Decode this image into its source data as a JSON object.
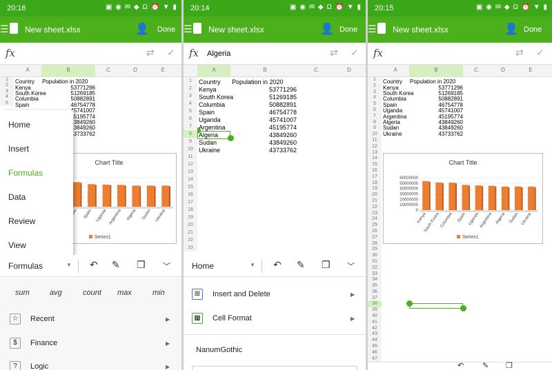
{
  "colors": {
    "accent": "#4caf1c",
    "status_bar": "#3aa818",
    "series": "#ed7d31"
  },
  "app": {
    "done": "Done"
  },
  "status": {
    "icons": "▣ ◉ ✉ ◆ Ω ⏰ ▼ ▮"
  },
  "panel1": {
    "time": "20:16",
    "title": "New sheet.xlsx",
    "fx_value": "",
    "toolbar_label": "Formulas"
  },
  "panel2": {
    "time": "20:14",
    "title": "New sheet.xlsx",
    "fx_value": "Algeria",
    "toolbar_label": "Home"
  },
  "panel3": {
    "time": "20:15",
    "title": "New sheet.xlsx",
    "fx_value": ""
  },
  "columns": [
    "A",
    "B",
    "C",
    "D",
    "E"
  ],
  "sheet": {
    "header": [
      "Country",
      "Population in 2020"
    ],
    "rows": [
      {
        "country": "Kenya",
        "pop": "53771296"
      },
      {
        "country": "South Korea",
        "pop": "51269185"
      },
      {
        "country": "Columbia",
        "pop": "50882891"
      },
      {
        "country": "Spain",
        "pop": "46754778"
      },
      {
        "country": "Uganda",
        "pop": "45741007"
      },
      {
        "country": "Argentina",
        "pop": "45195774"
      },
      {
        "country": "Algeria",
        "pop": "43849260"
      },
      {
        "country": "Sudan",
        "pop": "43849260"
      },
      {
        "country": "Ukraine",
        "pop": "43733762"
      }
    ]
  },
  "menu": [
    "Home",
    "Insert",
    "Formulas",
    "Data",
    "Review",
    "View"
  ],
  "menu_active": "Formulas",
  "formulas_ribbon": {
    "quick": [
      "sum",
      "avg",
      "count",
      "max",
      "min"
    ],
    "items": [
      "Recent",
      "Finance",
      "Logic"
    ]
  },
  "home_ribbon": {
    "items": [
      "Insert and Delete",
      "Cell Format"
    ],
    "font": "NanumGothic"
  },
  "chart_data": {
    "type": "bar",
    "title": "Chart Title",
    "categories": [
      "Kenya",
      "South Korea",
      "Columbia",
      "Spain",
      "Uganda",
      "Argentina",
      "Algeria",
      "Sudan",
      "Ukraine"
    ],
    "series": [
      {
        "name": "Series1",
        "values": [
          53771296,
          51269185,
          50882891,
          46754778,
          45741007,
          45195774,
          43849260,
          43849260,
          43733762
        ]
      }
    ],
    "ylim": [
      0,
      60000000
    ],
    "yticks": [
      "0",
      "10000000",
      "20000000",
      "30000000",
      "40000000",
      "50000000",
      "60000000"
    ],
    "legend": "bottom"
  },
  "chart_partial_labels": [
    "mbia",
    "Spain",
    "Uganda",
    "Argentina",
    "Algeria",
    "Sudan",
    "Ukraine"
  ]
}
